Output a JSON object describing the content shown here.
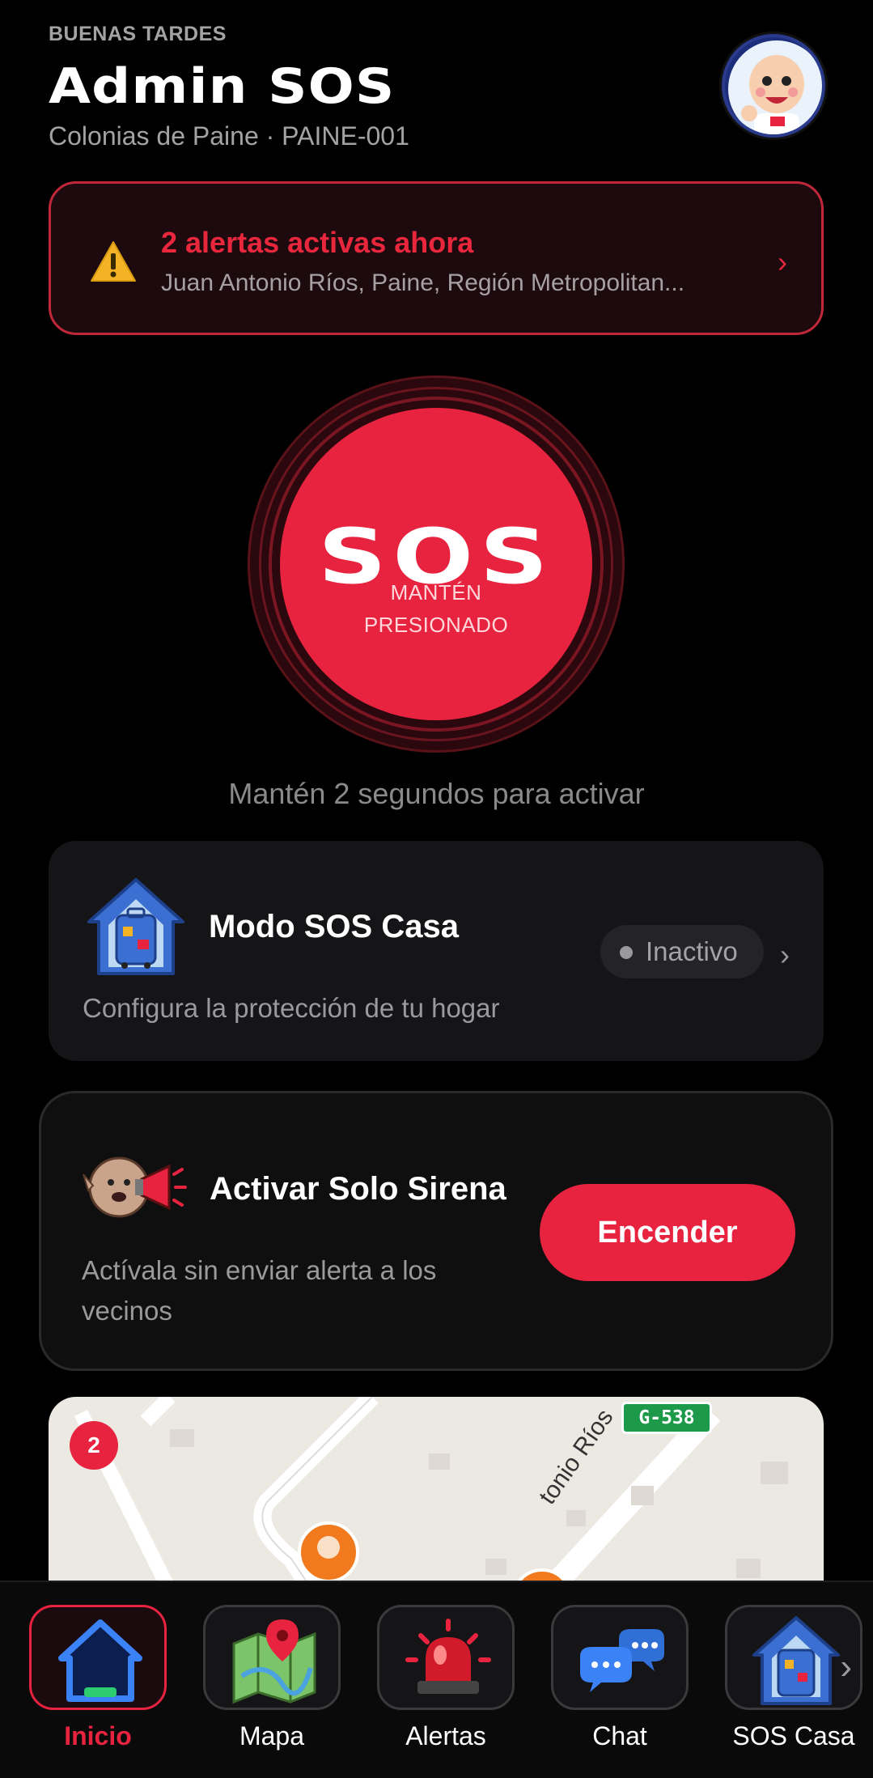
{
  "header": {
    "greeting": "BUENAS TARDES",
    "user_name": "Admin SOS",
    "community": "Colonias de Paine · PAINE-001",
    "avatar_icon": "mascot-avatar-icon"
  },
  "alert_banner": {
    "title": "2 alertas activas ahora",
    "address": "Juan Antonio Ríos, Paine, Región Metropolitan...",
    "icon": "warning-icon",
    "accent_color": "#e8273d"
  },
  "sos": {
    "label": "SOS",
    "hint_line1": "MANTÉN",
    "hint_line2": "PRESIONADO",
    "instruction": "Mantén 2 segundos para activar",
    "color": "#e8233f"
  },
  "casa_card": {
    "title": "Modo SOS Casa",
    "subtitle": "Configura la protección de tu hogar",
    "status": "Inactivo",
    "icon": "house-suitcase-icon"
  },
  "siren_card": {
    "title": "Activar Solo Sirena",
    "subtitle": "Actívala sin enviar alerta a los vecinos",
    "button_label": "Encender",
    "icon": "megaphone-icon"
  },
  "map": {
    "alert_count": "2",
    "road_sign": "G-538",
    "street_label": "tonio Ríos"
  },
  "bottom_nav": {
    "items": [
      {
        "label": "Inicio",
        "icon": "home-icon",
        "active": true
      },
      {
        "label": "Mapa",
        "icon": "map-icon",
        "active": false
      },
      {
        "label": "Alertas",
        "icon": "siren-light-icon",
        "active": false
      },
      {
        "label": "Chat",
        "icon": "chat-icon",
        "active": false
      },
      {
        "label": "SOS Casa",
        "icon": "house-suitcase-icon",
        "active": false
      }
    ]
  }
}
